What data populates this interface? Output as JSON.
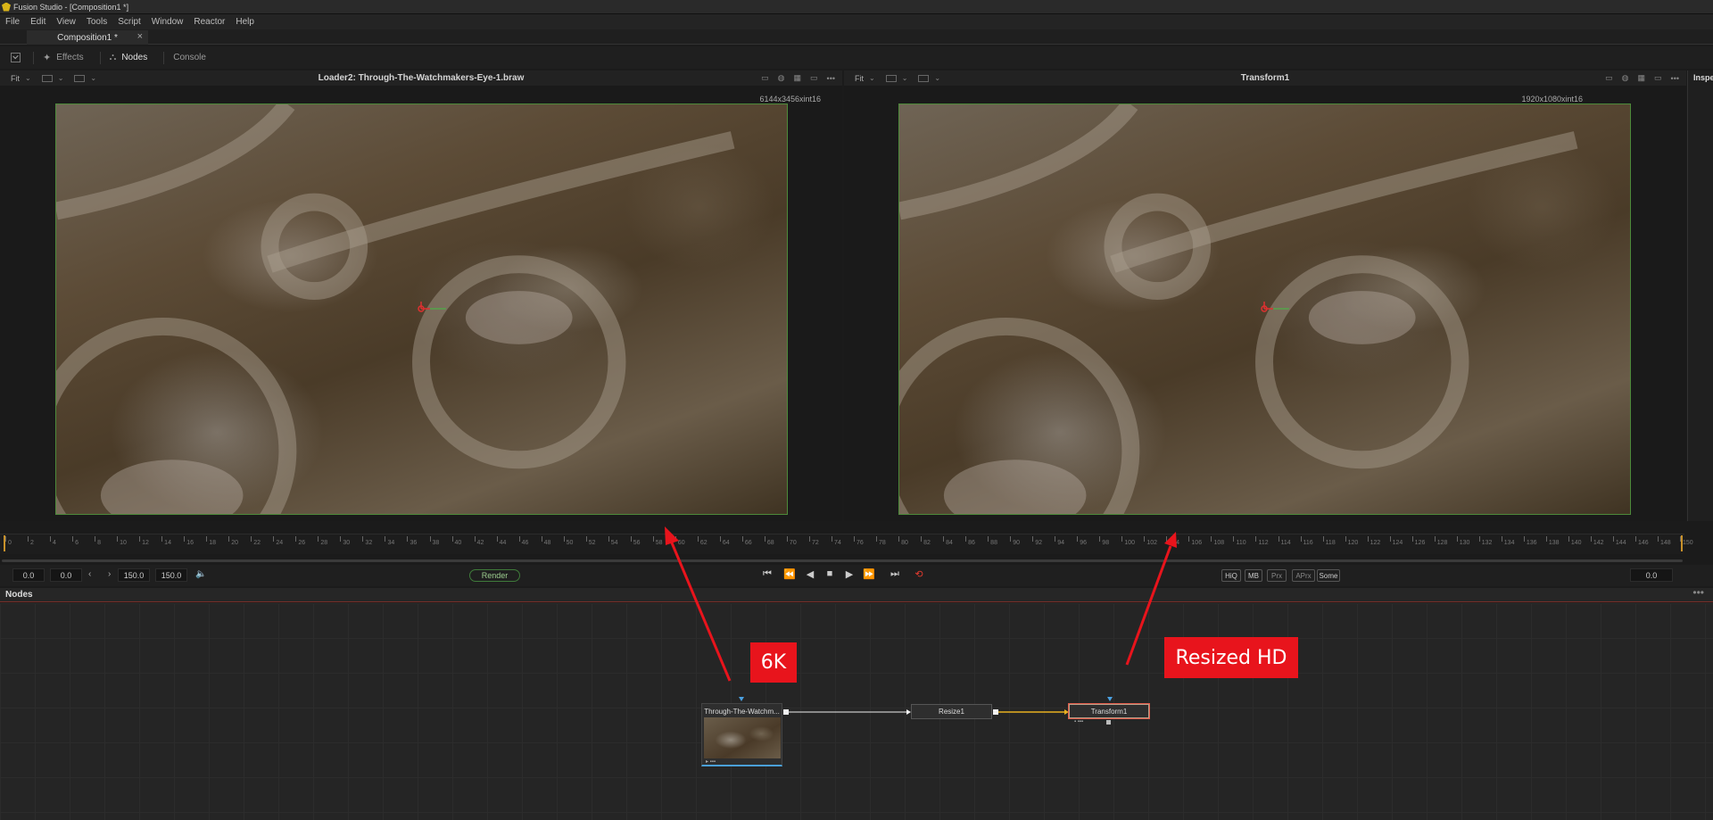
{
  "window": {
    "title": "Fusion Studio - [Composition1 *]"
  },
  "menu": [
    "File",
    "Edit",
    "View",
    "Tools",
    "Script",
    "Window",
    "Reactor",
    "Help"
  ],
  "tab": {
    "label": "Composition1 *",
    "close": "×"
  },
  "toolbar": {
    "effects": "Effects",
    "nodes": "Nodes",
    "console": "Console"
  },
  "viewer_left": {
    "fit": "Fit",
    "title": "Loader2: Through-The-Watchmakers-Eye-1.braw",
    "resolution": "6144x3456xint16"
  },
  "viewer_right": {
    "fit": "Fit",
    "title": "Transform1",
    "resolution": "1920x1080xint16"
  },
  "inspector": {
    "label": "Inspe"
  },
  "ruler": [
    "0",
    "2",
    "4",
    "6",
    "8",
    "10",
    "12",
    "14",
    "16",
    "18",
    "20",
    "22",
    "24",
    "26",
    "28",
    "30",
    "32",
    "34",
    "36",
    "38",
    "40",
    "42",
    "44",
    "46",
    "48",
    "50",
    "52",
    "54",
    "56",
    "58",
    "60",
    "62",
    "64",
    "66",
    "68",
    "70",
    "72",
    "74",
    "76",
    "78",
    "80",
    "82",
    "84",
    "86",
    "88",
    "90",
    "92",
    "94",
    "96",
    "98",
    "100",
    "102",
    "104",
    "106",
    "108",
    "110",
    "112",
    "114",
    "116",
    "118",
    "120",
    "122",
    "124",
    "126",
    "128",
    "130",
    "132",
    "134",
    "136",
    "138",
    "140",
    "142",
    "144",
    "146",
    "148",
    "150"
  ],
  "transport": {
    "global_start": "0.0",
    "render_start": "0.0",
    "render_end": "150.0",
    "global_end": "150.0",
    "current_time": "0.0",
    "render_label": "Render",
    "quality": [
      "HiQ",
      "MB",
      "Prx",
      "APrx",
      "Some"
    ]
  },
  "nodes_panel": {
    "label": "Nodes",
    "nodes": {
      "loader": "Through-The-Watchm...",
      "resize": "Resize1",
      "transform": "Transform1"
    }
  },
  "annotations": {
    "left": "6K",
    "right": "Resized HD"
  },
  "colors": {
    "accent_red": "#e8141c",
    "selection": "#e05a4a",
    "link_yellow": "#e8b020",
    "loader_blue": "#4aa0d8"
  }
}
